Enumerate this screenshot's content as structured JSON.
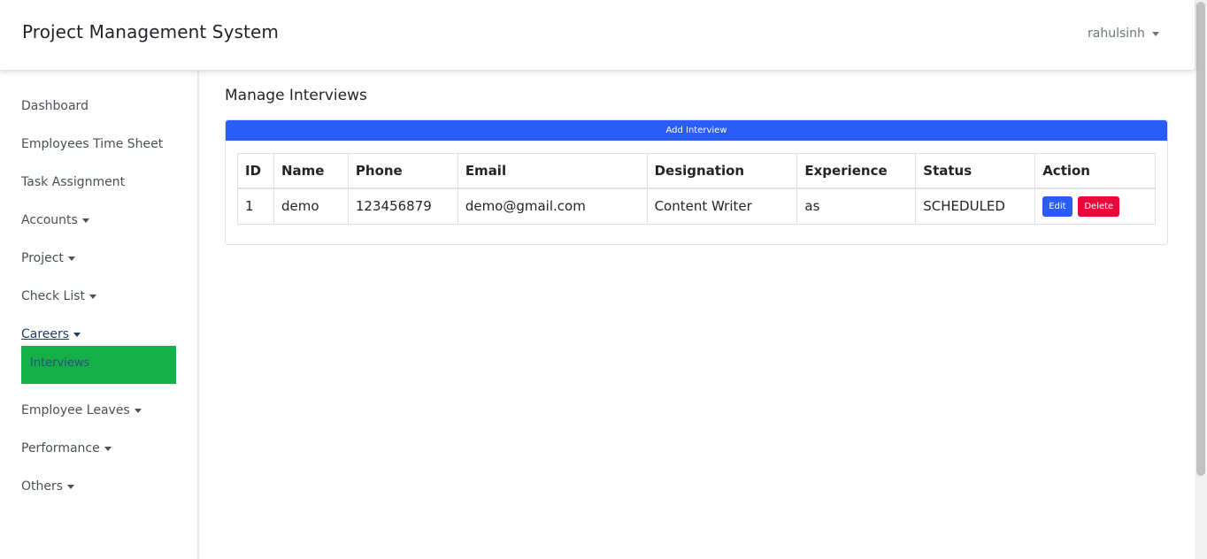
{
  "header": {
    "brand": "Project Management System",
    "user": "rahulsinh"
  },
  "sidebar": {
    "items": [
      {
        "label": "Dashboard",
        "dropdown": false
      },
      {
        "label": "Employees Time Sheet",
        "dropdown": false
      },
      {
        "label": "Task Assignment",
        "dropdown": false
      },
      {
        "label": "Accounts",
        "dropdown": true
      },
      {
        "label": "Project",
        "dropdown": true
      },
      {
        "label": "Check List",
        "dropdown": true
      },
      {
        "label": "Careers",
        "dropdown": true,
        "active": true
      },
      {
        "label": "Employee Leaves",
        "dropdown": true
      },
      {
        "label": "Performance",
        "dropdown": true
      },
      {
        "label": "Others",
        "dropdown": true
      }
    ],
    "careers_sub": {
      "label": "Interviews"
    }
  },
  "main": {
    "title": "Manage Interviews",
    "add_button": "Add Interview",
    "table": {
      "headers": [
        "ID",
        "Name",
        "Phone",
        "Email",
        "Designation",
        "Experience",
        "Status",
        "Action"
      ],
      "rows": [
        [
          "1",
          "demo",
          "123456879",
          "demo@gmail.com",
          "Content Writer",
          "as",
          "SCHEDULED"
        ]
      ],
      "actions": {
        "edit": "Edit",
        "delete": "Delete"
      }
    }
  },
  "colors": {
    "primary": "#2a5cf6",
    "danger": "#e8083a",
    "submenu_highlight": "#16b04b"
  }
}
